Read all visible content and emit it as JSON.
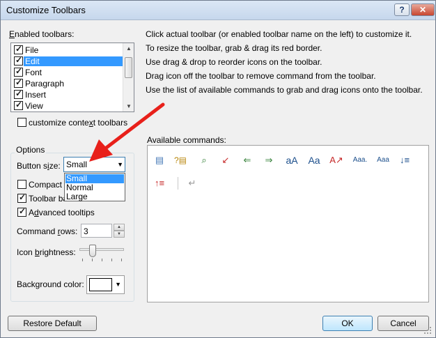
{
  "window": {
    "title": "Customize Toolbars",
    "help_glyph": "?",
    "close_glyph": "✕"
  },
  "enabled": {
    "label_prefix": "",
    "label_u": "E",
    "label_rest": "nabled toolbars:",
    "items": [
      {
        "label": "File",
        "checked": true,
        "selected": false
      },
      {
        "label": "Edit",
        "checked": true,
        "selected": true
      },
      {
        "label": "Font",
        "checked": true,
        "selected": false
      },
      {
        "label": "Paragraph",
        "checked": true,
        "selected": false
      },
      {
        "label": "Insert",
        "checked": true,
        "selected": false
      },
      {
        "label": "View",
        "checked": true,
        "selected": false
      }
    ]
  },
  "context": {
    "label_pre": "customize conte",
    "label_u": "x",
    "label_post": "t toolbars",
    "checked": false
  },
  "options": {
    "group_title": "Options",
    "button_size": {
      "label_pre": "Button s",
      "label_u": "i",
      "label_post": "ze:",
      "value": "Small",
      "options": [
        "Small",
        "Normal",
        "Large"
      ],
      "highlighted": "Small"
    },
    "compact": {
      "label": "Compact b",
      "checked": false
    },
    "toolbar_bg": {
      "label": "Toolbar ba",
      "checked": true
    },
    "advanced": {
      "label_pre": "A",
      "label_u": "d",
      "label_post": "vanced tooltips",
      "checked": true
    },
    "rows": {
      "label_pre": "Command ",
      "label_u": "r",
      "label_post": "ows:",
      "value": "3"
    },
    "brightness": {
      "label_pre": "Icon ",
      "label_u": "b",
      "label_post": "rightness:",
      "level": 0.25
    },
    "bg_color": {
      "label": "Background color:",
      "color": "#ffffff"
    }
  },
  "instructions": [
    "Click actual toolbar (or enabled toolbar name on the left) to customize it.",
    "To resize the toolbar, grab & drag its red border.",
    "Use drag & drop to reorder icons on the toolbar.",
    "Drag icon off the toolbar to remove command from the toolbar.",
    "Use the list of available commands to grab and drag icons onto the toolbar."
  ],
  "commands": {
    "label": "Available commands:",
    "icons": [
      {
        "name": "paste-icon",
        "glyph": "📋"
      },
      {
        "name": "paste-special-icon",
        "glyph": "?📋"
      },
      {
        "name": "find-replace-icon",
        "glyph": "🔍"
      },
      {
        "name": "insert-line-icon",
        "glyph": "↙"
      },
      {
        "name": "move-up-icon",
        "glyph": "⇡"
      },
      {
        "name": "move-down-icon",
        "glyph": "⇣"
      },
      {
        "name": "grow-font-icon",
        "glyph": "aA"
      },
      {
        "name": "font-case-icon",
        "glyph": "Aa"
      },
      {
        "name": "clear-format-icon",
        "glyph": "A✕"
      },
      {
        "name": "small-caps-icon",
        "glyph": "Aaa."
      },
      {
        "name": "change-case-icon",
        "glyph": "Aaa"
      },
      {
        "name": "indent-down-icon",
        "glyph": "↓≡"
      },
      {
        "name": "indent-up-icon",
        "glyph": "↑≡"
      },
      {
        "name": "return-icon",
        "glyph": "↵"
      }
    ]
  },
  "buttons": {
    "restore": "Restore Default",
    "ok": "OK",
    "cancel": "Cancel"
  },
  "colors": {
    "selection": "#3399ff",
    "arrow": "#e8201a",
    "accent": "#3c7fb1"
  }
}
